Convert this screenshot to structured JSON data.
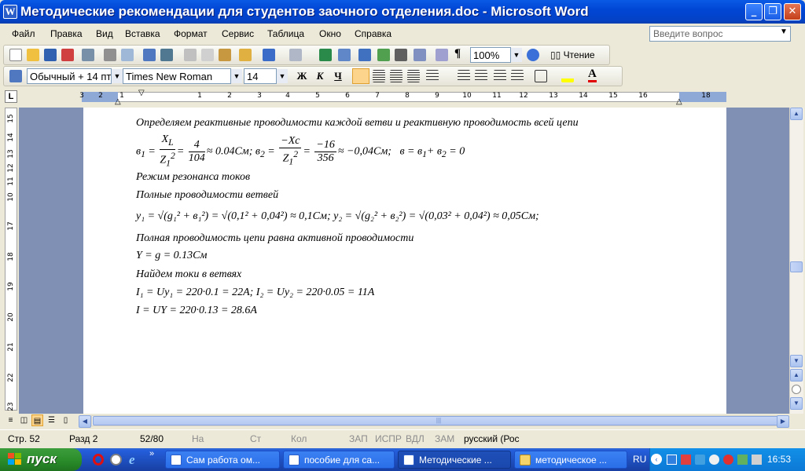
{
  "window": {
    "title": "Методические рекомендации для студентов заочного отделения.doc - Microsoft Word",
    "controls": {
      "minimize": "_",
      "restore": "❐",
      "close": "✕"
    }
  },
  "menu": {
    "items": [
      "Файл",
      "Правка",
      "Вид",
      "Вставка",
      "Формат",
      "Сервис",
      "Таблица",
      "Окно",
      "Справка"
    ],
    "help_placeholder": "Введите вопрос"
  },
  "toolbar": {
    "zoom": "100%",
    "reading_label": "Чтение",
    "style": "Обычный + 14 пт",
    "font": "Times New Roman",
    "size": "14",
    "bold": "Ж",
    "italic": "К",
    "underline": "Ч"
  },
  "ruler": {
    "h_numbers": [
      "3",
      "2",
      "1",
      "1",
      "2",
      "3",
      "4",
      "5",
      "6",
      "7",
      "8",
      "9",
      "10",
      "11",
      "12",
      "13",
      "14",
      "15",
      "16",
      "18"
    ],
    "v_numbers": [
      "15",
      "14",
      "13",
      "12",
      "11",
      "10",
      "17",
      "18",
      "19",
      "20",
      "21",
      "22",
      "23"
    ]
  },
  "document": {
    "line1": "Определяем реактивные проводимости каждой ветви и реактивную проводимость всей цепи",
    "formula1": {
      "b1": "в",
      "x_num": "X",
      "x_sub": "L",
      "z_den": "Z",
      "z_sub": "1",
      "z_sup": "2",
      "n1": "4",
      "d1": "104",
      "r1": "≈ 0.04См; в",
      "xc_num": "−Xc",
      "n2": "−16",
      "d2": "356",
      "r2": "≈ −0,04См;",
      "b_total": "в = в",
      "b_total_tail": "+ в",
      "b_total_res": "= 0"
    },
    "line2": "Режим резонанса токов",
    "line3": "Полные проводимости ветвей",
    "formula2": "y₁ = √(g₁² + в₁²) = √(0,1² + 0,04²) ≈ 0,1См; y₂ = √(g₂² + в₂²) = √(0,03² + 0,04²) ≈ 0,05См;",
    "line4": "Полная проводимость цепи равна активной проводимости",
    "formula3": "Y = g = 0.13См",
    "line5": "Найдем токи в ветвях",
    "formula4": "I₁ = Uy₁ = 220·0.1 = 22А;   I₂ = Uy₂ = 220·0.05 = 11А",
    "formula5": "I = UY = 220·0.13 = 28.6А"
  },
  "status": {
    "page": "Стр. 52",
    "section": "Разд 2",
    "pages": "52/80",
    "at": "На",
    "line": "Ст",
    "col": "Кол",
    "rec": "ЗАП",
    "trk": "ИСПР",
    "ext": "ВДЛ",
    "ovr": "ЗАМ",
    "lang": "русский (Рос"
  },
  "taskbar": {
    "start": "пуск",
    "tasks": [
      "Сам работа ом...",
      "пособие для са...",
      "Методические ...",
      "методическое ..."
    ],
    "lang": "RU",
    "time": "16:53"
  },
  "colors": {
    "titlebar": "#0046d5",
    "workspace": "#7f90b4",
    "taskbar": "#245edb",
    "start": "#2b8e2b"
  }
}
